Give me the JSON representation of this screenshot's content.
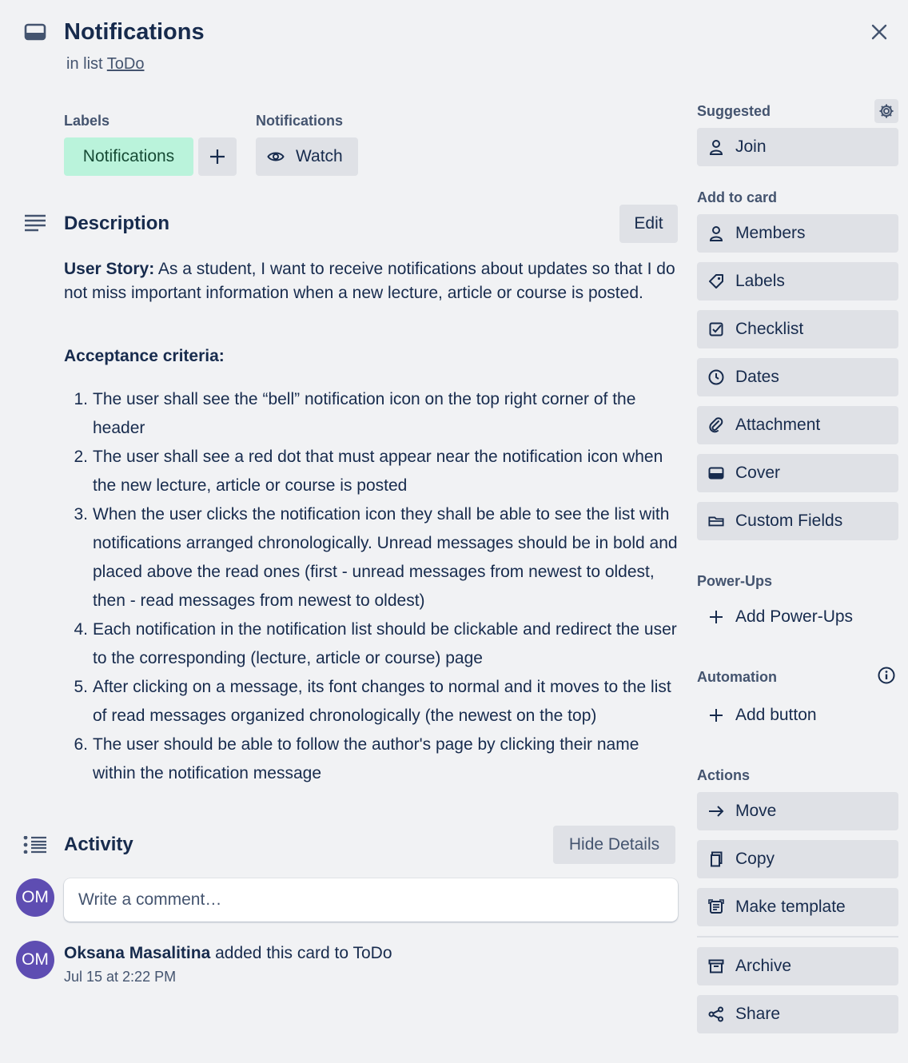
{
  "card": {
    "title": "Notifications",
    "in_list_prefix": "in list",
    "list_name": "ToDo"
  },
  "labels_section": {
    "heading": "Labels",
    "label": "Notifications",
    "label_color": "#baf3db"
  },
  "notifications_section": {
    "heading": "Notifications",
    "watch_label": "Watch"
  },
  "description": {
    "title": "Description",
    "edit_label": "Edit",
    "story_label": "User Story:",
    "story_text": "As a student, I want to receive notifications about updates so that I do not miss important information when a new lecture, article or course is posted.",
    "criteria_heading": "Acceptance criteria:",
    "criteria": [
      {
        "num": "1.",
        "text": "The user shall see the “bell” notification icon on the top right corner of the header"
      },
      {
        "num": "2.",
        "text": "The user shall see a red dot that must appear near the notification icon when the new lecture, article or course is posted"
      },
      {
        "num": "3.",
        "text": "When the user clicks the notification icon they shall be able to see the list with notifications arranged chronologically. Unread messages should be in bold and placed above the read ones (first - unread messages from newest to oldest, then - read messages from newest to oldest)"
      },
      {
        "num": "4.",
        "text": "Each notification in the notification list should be clickable and redirect the user to the corresponding (lecture, article or course) page"
      },
      {
        "num": "5.",
        "text": "After clicking on a message, its font changes to normal and it moves to the list of read messages organized chronologically (the newest on the top)"
      },
      {
        "num": "6.",
        "text": "The user should be able to follow the author's page by clicking their name within the notification message"
      }
    ]
  },
  "activity": {
    "title": "Activity",
    "hide_details_label": "Hide Details",
    "comment_placeholder": "Write a comment…",
    "current_user_initials": "OM",
    "entries": [
      {
        "initials": "OM",
        "user": "Oksana Masalitina",
        "action": "added this card to ToDo",
        "time": "Jul 15 at 2:22 PM"
      }
    ]
  },
  "sidebar": {
    "suggested": {
      "heading": "Suggested",
      "join_label": "Join"
    },
    "add_to_card": {
      "heading": "Add to card",
      "items": [
        {
          "label": "Members",
          "icon": "person-icon"
        },
        {
          "label": "Labels",
          "icon": "tag-icon"
        },
        {
          "label": "Checklist",
          "icon": "checkbox-icon"
        },
        {
          "label": "Dates",
          "icon": "clock-icon"
        },
        {
          "label": "Attachment",
          "icon": "paperclip-icon"
        },
        {
          "label": "Cover",
          "icon": "cover-icon"
        },
        {
          "label": "Custom Fields",
          "icon": "custom-fields-icon"
        }
      ]
    },
    "power_ups": {
      "heading": "Power-Ups",
      "add_label": "Add Power-Ups"
    },
    "automation": {
      "heading": "Automation",
      "add_label": "Add button"
    },
    "actions": {
      "heading": "Actions",
      "items": [
        {
          "label": "Move",
          "icon": "arrow-right-icon"
        },
        {
          "label": "Copy",
          "icon": "copy-icon"
        },
        {
          "label": "Make template",
          "icon": "template-icon"
        },
        {
          "label": "Archive",
          "icon": "archive-icon"
        },
        {
          "label": "Share",
          "icon": "share-icon"
        }
      ]
    }
  },
  "colors": {
    "background": "#f1f2f4",
    "button_bg": "#dfe1e6",
    "avatar": "#5e4db2",
    "text": "#172b4d"
  }
}
